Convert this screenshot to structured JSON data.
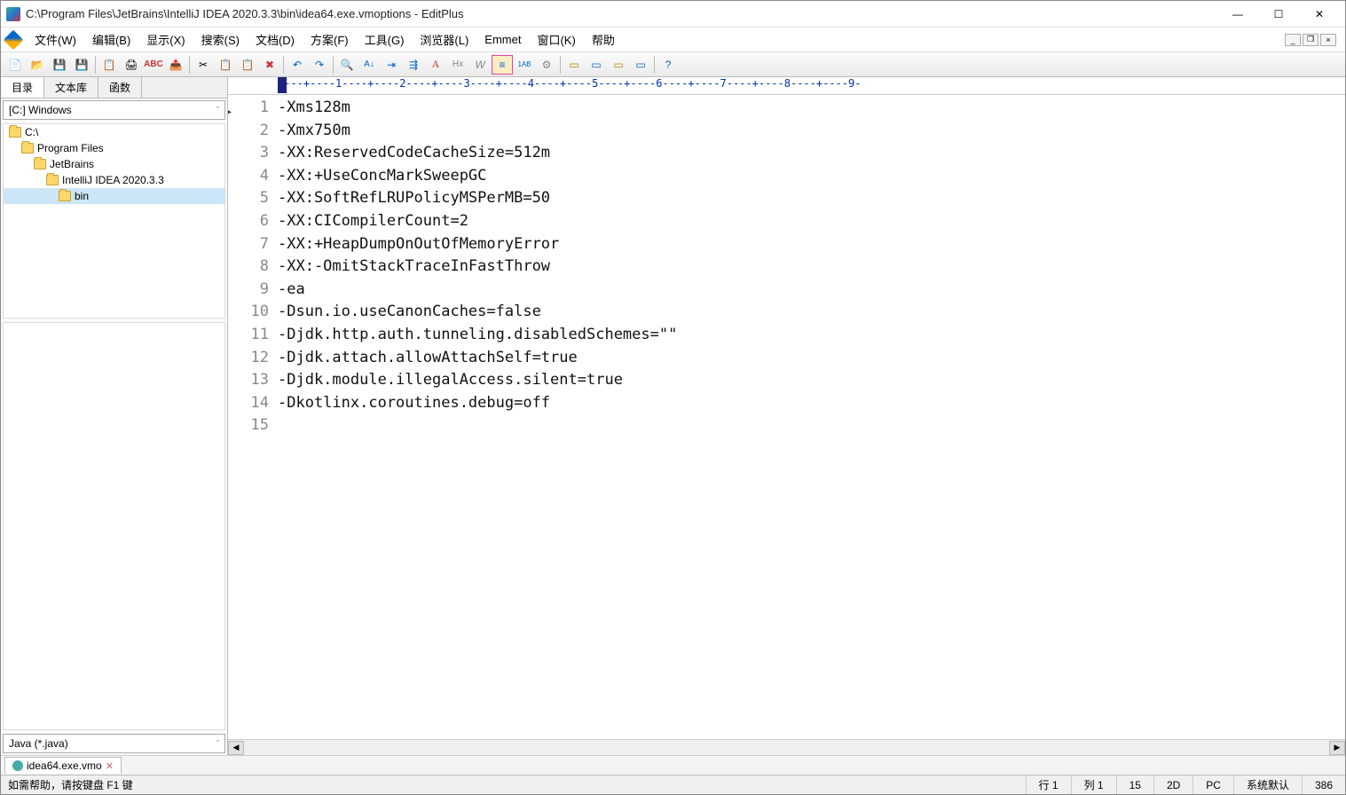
{
  "titlebar": {
    "title": "C:\\Program Files\\JetBrains\\IntelliJ IDEA 2020.3.3\\bin\\idea64.exe.vmoptions - EditPlus"
  },
  "menu": {
    "items": [
      "文件(W)",
      "编辑(B)",
      "显示(X)",
      "搜索(S)",
      "文档(D)",
      "方案(F)",
      "工具(G)",
      "浏览器(L)",
      "Emmet",
      "窗口(K)",
      "帮助"
    ]
  },
  "sidebar": {
    "tabs": [
      "目录",
      "文本库",
      "函数"
    ],
    "drive": "[C:] Windows",
    "tree": [
      {
        "label": "C:\\",
        "indent": 0
      },
      {
        "label": "Program Files",
        "indent": 1
      },
      {
        "label": "JetBrains",
        "indent": 2
      },
      {
        "label": "IntelliJ IDEA 2020.3.3",
        "indent": 3
      },
      {
        "label": "bin",
        "indent": 4,
        "selected": true
      }
    ],
    "filetype": "Java (*.java)"
  },
  "ruler": {
    "text": "----+----1----+----2----+----3----+----4----+----5----+----6----+----7----+----8----+----9-"
  },
  "code": {
    "lines": [
      "-Xms128m",
      "-Xmx750m",
      "-XX:ReservedCodeCacheSize=512m",
      "-XX:+UseConcMarkSweepGC",
      "-XX:SoftRefLRUPolicyMSPerMB=50",
      "-XX:CICompilerCount=2",
      "-XX:+HeapDumpOnOutOfMemoryError",
      "-XX:-OmitStackTraceInFastThrow",
      "-ea",
      "-Dsun.io.useCanonCaches=false",
      "-Djdk.http.auth.tunneling.disabledSchemes=\"\"",
      "-Djdk.attach.allowAttachSelf=true",
      "-Djdk.module.illegalAccess.silent=true",
      "-Dkotlinx.coroutines.debug=off",
      ""
    ]
  },
  "doctab": {
    "label": "idea64.exe.vmo"
  },
  "status": {
    "help": "如需帮助，请按键盘 F1 键",
    "line": "行 1",
    "col": "列 1",
    "total": "15",
    "enc": "2D",
    "platform": "PC",
    "charset": "系统默认",
    "num": "386"
  },
  "icons": {
    "min": "—",
    "max": "☐",
    "close": "✕",
    "chev": "ˇ",
    "left": "◀",
    "right": "▶"
  }
}
